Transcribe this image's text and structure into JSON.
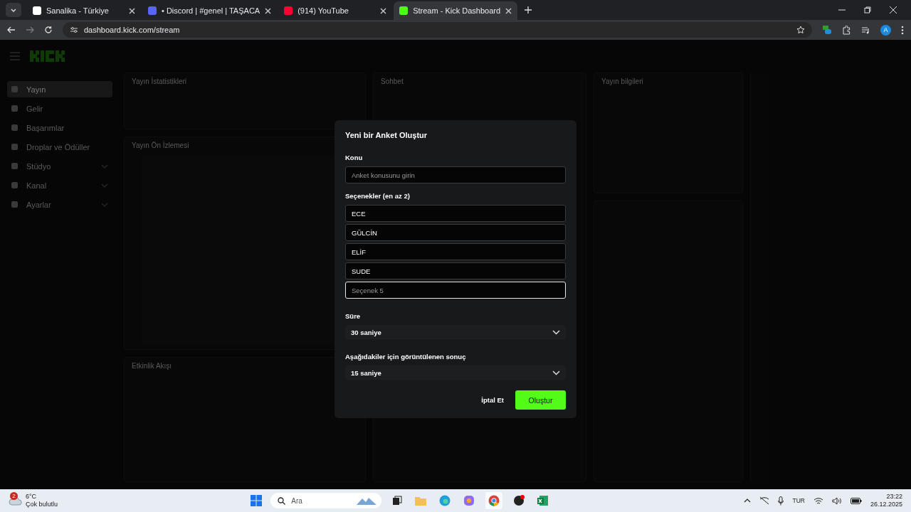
{
  "browser": {
    "tabs": [
      {
        "title": "Sanalika - Türkiye",
        "kind": "sanalika",
        "selected": false
      },
      {
        "title": "• Discord | #genel | TAŞACA",
        "kind": "discord",
        "selected": false
      },
      {
        "title": "(914) YouTube",
        "kind": "youtube",
        "selected": false
      },
      {
        "title": "Stream - Kick Dashboard",
        "kind": "kick",
        "selected": true
      }
    ],
    "address": "dashboard.kick.com/stream",
    "profile_initial": "A"
  },
  "sidebar": {
    "items": [
      {
        "label": "Yayın",
        "expandable": false,
        "selected": true
      },
      {
        "label": "Gelir",
        "expandable": false,
        "selected": false
      },
      {
        "label": "Başarımlar",
        "expandable": false,
        "selected": false
      },
      {
        "label": "Droplar ve Ödüller",
        "expandable": false,
        "selected": false
      },
      {
        "label": "Stüdyo",
        "expandable": true,
        "selected": false
      },
      {
        "label": "Kanal",
        "expandable": true,
        "selected": false
      },
      {
        "label": "Ayarlar",
        "expandable": true,
        "selected": false
      }
    ]
  },
  "panels": [
    "Yayın İstatistikleri",
    "Yayın Ön İzlemesi",
    "Etkinlik Akışı",
    "Sohbet",
    "Yayın bilgileri"
  ],
  "dialog": {
    "title": "Yeni bir Anket Oluştur",
    "topic_label": "Konu",
    "topic": {
      "placeholder": "Anket konusunu girin"
    },
    "options_label": "Seçenekler (en az 2)",
    "options": [
      {
        "value": "ECE",
        "focused": false
      },
      {
        "value": "GÜLCİN",
        "focused": false
      },
      {
        "value": "ELİF",
        "focused": false
      },
      {
        "value": "SUDE",
        "focused": false
      },
      {
        "placeholder": "Seçenek 5",
        "focused": true
      }
    ],
    "duration_label": "Süre",
    "duration": "30 saniye",
    "result_label": "Aşağıdakiler için görüntülenen sonuç",
    "result": "15 saniye",
    "cancel": "İptal Et",
    "create": "Oluştur"
  },
  "taskbar": {
    "weather_badge": "2",
    "temperature": "6°C",
    "weather": "Çok bulutlu",
    "search_placeholder": "Ara",
    "language": "TUR",
    "time": "23:22",
    "date": "26.12.2025"
  }
}
